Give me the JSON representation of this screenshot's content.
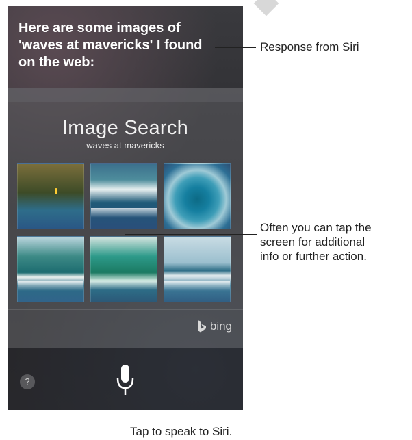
{
  "siri": {
    "response_lines": [
      "Here are some images of",
      "'waves at mavericks' I found",
      "on the web:"
    ],
    "card": {
      "title": "Image Search",
      "subtitle": "waves at mavericks",
      "provider": "bing"
    },
    "help_label": "?"
  },
  "callouts": {
    "response": "Response from Siri",
    "tap_lines": [
      "Often you can tap the",
      "screen for additional",
      "info or further action."
    ],
    "speak": "Tap to speak to Siri."
  },
  "icons": [
    "microphone-icon",
    "bing-logo-icon",
    "help-icon"
  ],
  "colors": {
    "screen": "#2f2f33",
    "text": "#ffffff",
    "callout_text": "#222222"
  }
}
